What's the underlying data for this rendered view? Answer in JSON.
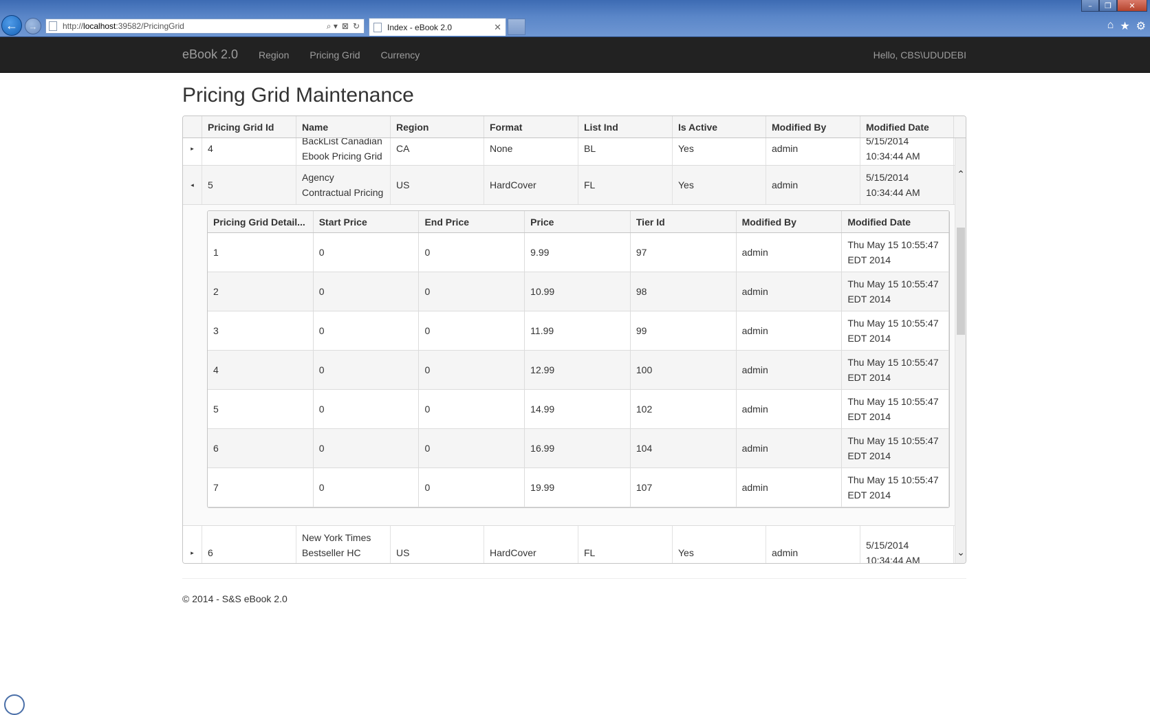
{
  "browser": {
    "url_prefix": "http://",
    "url_host": "localhost",
    "url_rest": ":39582/PricingGrid",
    "tab_title": "Index - eBook 2.0",
    "window_buttons": [
      "–",
      "❐",
      "✕"
    ],
    "addr_tool_icons": [
      "⌕ ▾",
      "⊠",
      "↻"
    ],
    "tab_close": "✕",
    "nav_back": "←",
    "nav_forward": "→",
    "home_icon": "⌂",
    "favorites_icon": "★",
    "tools_icon": "⚙"
  },
  "navbar": {
    "brand": "eBook 2.0",
    "links": [
      "Region",
      "Pricing Grid",
      "Currency"
    ],
    "greeting": "Hello, CBS\\UDUDEBI"
  },
  "page": {
    "title": "Pricing Grid Maintenance"
  },
  "grid": {
    "columns": [
      "Pricing Grid Id",
      "Name",
      "Region",
      "Format",
      "List Ind",
      "Is Active",
      "Modified By",
      "Modified Date"
    ],
    "rows": [
      {
        "toggle": "▸",
        "id": "4",
        "name": "BackList Canadian Ebook Pricing Grid",
        "region": "CA",
        "format": "None",
        "list_ind": "BL",
        "is_active": "Yes",
        "modified_by": "admin",
        "modified_date": "5/15/2014 10:34:44 AM"
      },
      {
        "toggle": "◂",
        "id": "5",
        "name": "Agency Contractual Pricing",
        "region": "US",
        "format": "HardCover",
        "list_ind": "FL",
        "is_active": "Yes",
        "modified_by": "admin",
        "modified_date": "5/15/2014 10:34:44 AM"
      },
      {
        "toggle": "▸",
        "id": "6",
        "name": "New York Times Bestseller HC FrontList Grid",
        "region": "US",
        "format": "HardCover",
        "list_ind": "FL",
        "is_active": "Yes",
        "modified_by": "admin",
        "modified_date": "5/15/2014 10:34:44 AM"
      }
    ],
    "scroll_up": "⌃",
    "scroll_down": "⌄"
  },
  "detail": {
    "columns": [
      "Pricing Grid Detail...",
      "Start Price",
      "End Price",
      "Price",
      "Tier Id",
      "Modified By",
      "Modified Date"
    ],
    "rows": [
      [
        "1",
        "0",
        "0",
        "9.99",
        "97",
        "admin",
        "Thu May 15 10:55:47 EDT 2014"
      ],
      [
        "2",
        "0",
        "0",
        "10.99",
        "98",
        "admin",
        "Thu May 15 10:55:47 EDT 2014"
      ],
      [
        "3",
        "0",
        "0",
        "11.99",
        "99",
        "admin",
        "Thu May 15 10:55:47 EDT 2014"
      ],
      [
        "4",
        "0",
        "0",
        "12.99",
        "100",
        "admin",
        "Thu May 15 10:55:47 EDT 2014"
      ],
      [
        "5",
        "0",
        "0",
        "14.99",
        "102",
        "admin",
        "Thu May 15 10:55:47 EDT 2014"
      ],
      [
        "6",
        "0",
        "0",
        "16.99",
        "104",
        "admin",
        "Thu May 15 10:55:47 EDT 2014"
      ],
      [
        "7",
        "0",
        "0",
        "19.99",
        "107",
        "admin",
        "Thu May 15 10:55:47 EDT 2014"
      ]
    ]
  },
  "footer": {
    "text": "© 2014 - S&S eBook 2.0"
  }
}
